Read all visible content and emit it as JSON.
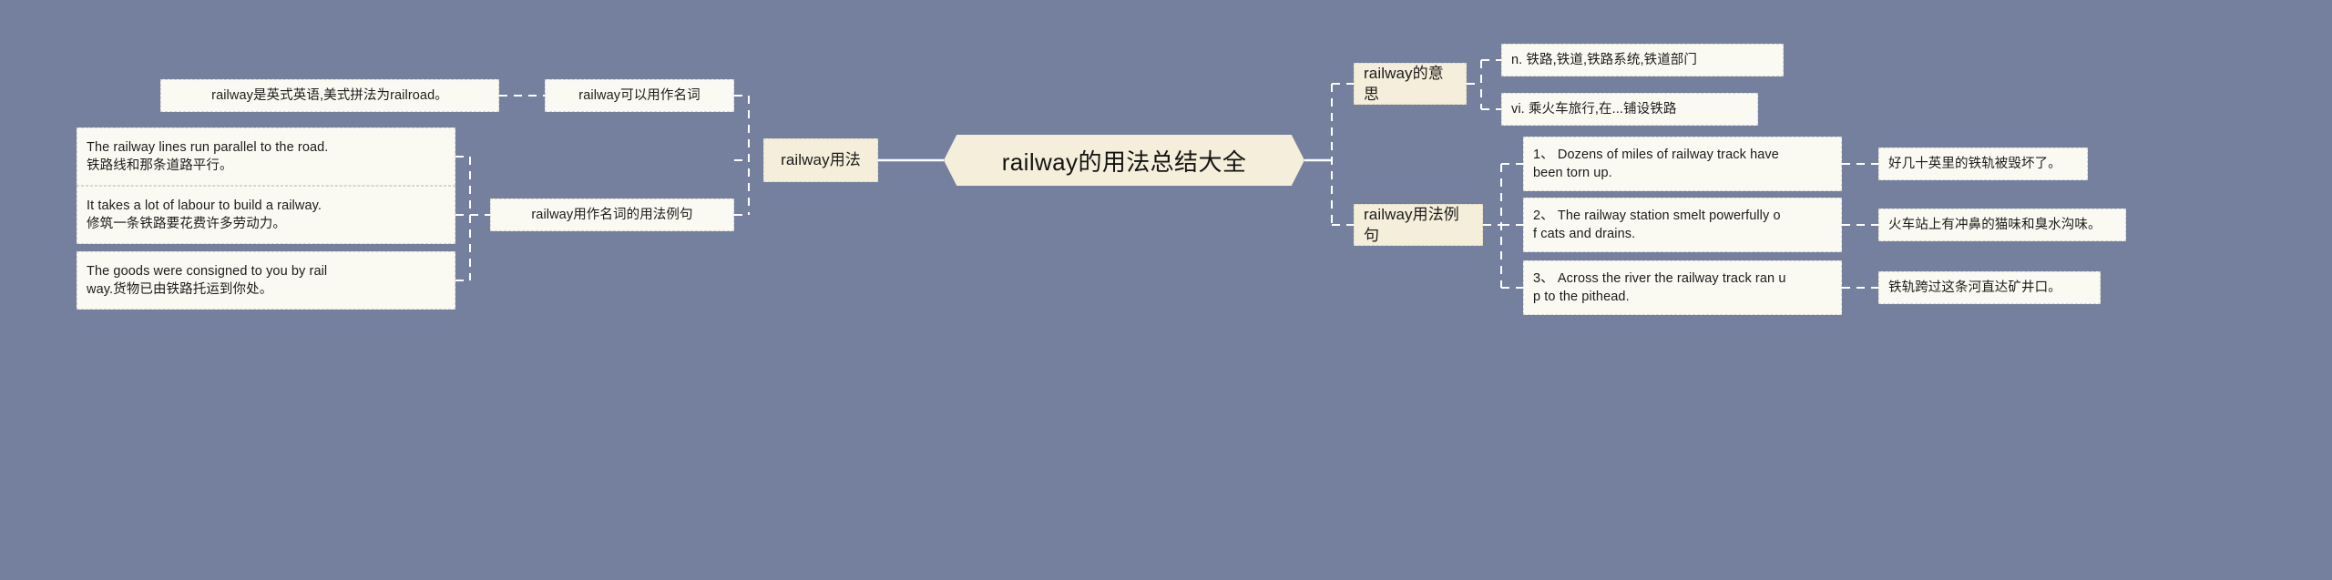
{
  "mindmap": {
    "background_color": "#74809e",
    "node_fill": "#fbfaf2",
    "branch_fill": "#f4eeda",
    "connector_color": "#ffffff",
    "center": {
      "label": "railway的用法总结大全"
    },
    "left": {
      "branch": {
        "label": "railway用法"
      },
      "sub_nodes": [
        {
          "label": "railway可以用作名词"
        },
        {
          "label": "railway用作名词的用法例句"
        }
      ],
      "leaves": [
        {
          "label": "railway是英式英语,美式拼法为railroad。"
        },
        {
          "label": "The railway lines run parallel to the road.\n铁路线和那条道路平行。"
        },
        {
          "label": "It takes a lot of labour to build a railway.\n修筑一条铁路要花费许多劳动力。"
        },
        {
          "label": "The goods were consigned to you by rail\nway.货物已由铁路托运到你处。"
        }
      ]
    },
    "right": {
      "branches": [
        {
          "label": "railway的意思"
        },
        {
          "label": "railway用法例句"
        }
      ],
      "meanings": [
        {
          "label": "n. 铁路,铁道,铁路系统,铁道部门"
        },
        {
          "label": "vi. 乘火车旅行,在...铺设铁路"
        }
      ],
      "examples": [
        {
          "sentence": "1、 Dozens of miles of railway track have\nbeen torn up.",
          "translation": "好几十英里的铁轨被毁坏了。"
        },
        {
          "sentence": "2、 The railway station smelt powerfully o\nf cats and drains.",
          "translation": "火车站上有冲鼻的猫味和臭水沟味。"
        },
        {
          "sentence": "3、 Across the river the railway track ran u\np to the pithead.",
          "translation": "铁轨跨过这条河直达矿井口。"
        }
      ]
    }
  }
}
